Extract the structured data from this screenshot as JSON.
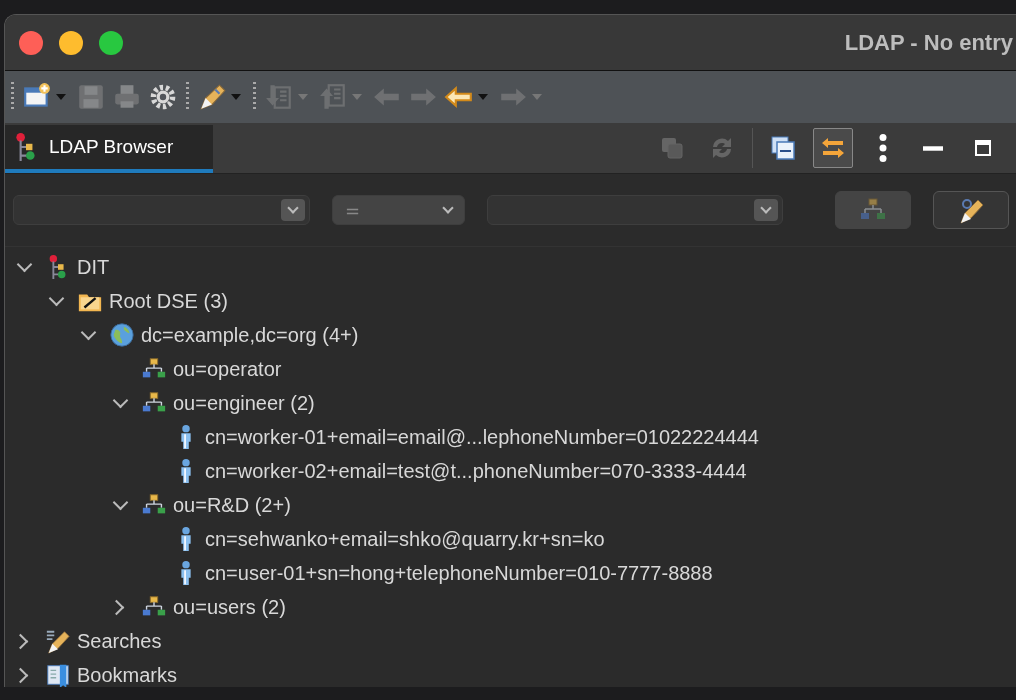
{
  "window": {
    "title": "LDAP - No entry"
  },
  "toolbar": [
    {
      "kind": "grip"
    },
    {
      "kind": "new-window",
      "menu": true,
      "disabled": false
    },
    {
      "kind": "save",
      "menu": false,
      "disabled": true
    },
    {
      "kind": "print",
      "menu": false,
      "disabled": true
    },
    {
      "kind": "gear",
      "menu": false,
      "disabled": false
    },
    {
      "kind": "grip"
    },
    {
      "kind": "pen",
      "menu": true,
      "disabled": false
    },
    {
      "kind": "grip"
    },
    {
      "kind": "import",
      "menu": true,
      "disabled": true
    },
    {
      "kind": "export",
      "menu": true,
      "disabled": true
    },
    {
      "kind": "back-jump",
      "menu": false,
      "disabled": true
    },
    {
      "kind": "forward-jump",
      "menu": false,
      "disabled": true
    },
    {
      "kind": "back",
      "menu": true,
      "disabled": false
    },
    {
      "kind": "forward",
      "menu": true,
      "disabled": true
    }
  ],
  "tabs": [
    {
      "label": "LDAP Browser",
      "selected": true
    }
  ],
  "view_actions": [
    {
      "kind": "copy",
      "disabled": true,
      "pressed": false
    },
    {
      "kind": "refresh",
      "disabled": true,
      "pressed": false
    },
    {
      "kind": "divider"
    },
    {
      "kind": "collapse",
      "disabled": false,
      "pressed": false
    },
    {
      "kind": "link",
      "disabled": false,
      "pressed": true
    },
    {
      "kind": "more",
      "disabled": false,
      "pressed": false
    },
    {
      "kind": "minimize",
      "disabled": false,
      "pressed": false
    },
    {
      "kind": "maximize",
      "disabled": false,
      "pressed": false
    }
  ],
  "filter": {
    "operator": {
      "value": "="
    },
    "buttons": [
      {
        "kind": "ou",
        "disabled": true
      },
      {
        "kind": "search",
        "disabled": false
      }
    ]
  },
  "tree": [
    {
      "label": "DIT",
      "kind": "dit",
      "expanded": true,
      "children": [
        {
          "label": "Root DSE (3)",
          "kind": "root-dse",
          "expanded": true,
          "children": [
            {
              "label": "dc=example,dc=org (4+)",
              "kind": "domain",
              "expanded": true,
              "children": [
                {
                  "label": "ou=operator",
                  "kind": "ou"
                },
                {
                  "label": "ou=engineer (2)",
                  "kind": "ou",
                  "expanded": true,
                  "children": [
                    {
                      "label": "cn=worker-01+email=email@...lephoneNumber=01022224444",
                      "kind": "person"
                    },
                    {
                      "label": "cn=worker-02+email=test@t...phoneNumber=070-3333-4444",
                      "kind": "person"
                    }
                  ]
                },
                {
                  "label": "ou=R&D (2+)",
                  "kind": "ou",
                  "expanded": true,
                  "children": [
                    {
                      "label": "cn=sehwanko+email=shko@quarry.kr+sn=ko",
                      "kind": "person"
                    },
                    {
                      "label": "cn=user-01+sn=hong+telephoneNumber=010-7777-8888",
                      "kind": "person"
                    }
                  ]
                },
                {
                  "label": "ou=users (2)",
                  "kind": "ou",
                  "expanded": false
                }
              ]
            }
          ]
        }
      ]
    },
    {
      "label": "Searches",
      "kind": "searches",
      "expanded": false
    },
    {
      "label": "Bookmarks",
      "kind": "bookmarks",
      "expanded": false
    }
  ]
}
